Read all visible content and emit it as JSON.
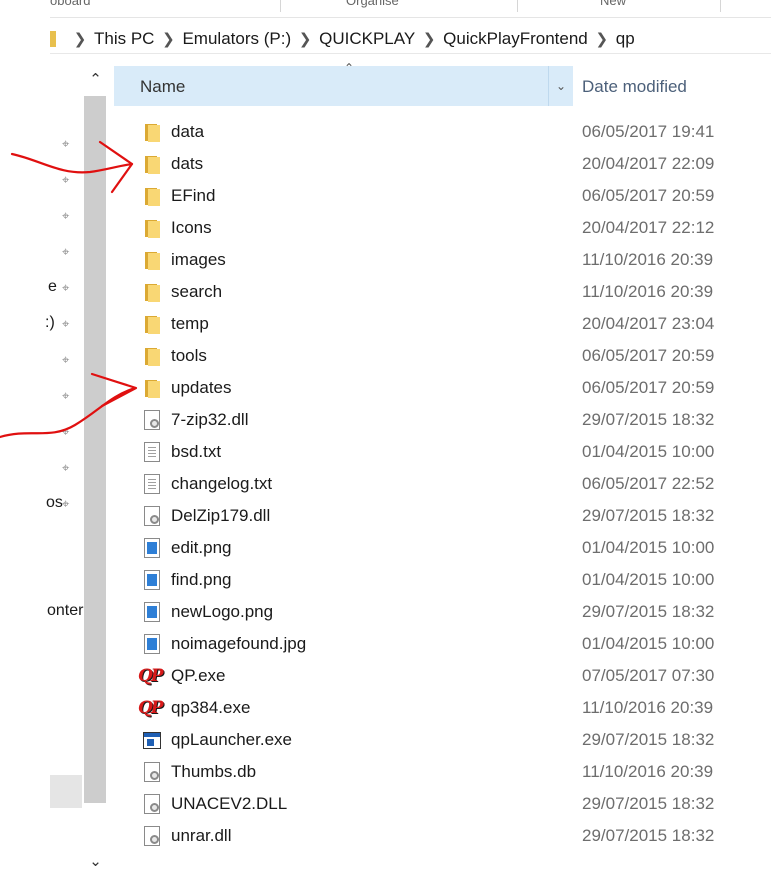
{
  "ribbon": {
    "groups": [
      "oboard",
      "Organise",
      "New"
    ]
  },
  "address": {
    "segments": [
      "This PC",
      "Emulators (P:)",
      "QUICKPLAY",
      "QuickPlayFrontend",
      "qp"
    ]
  },
  "nav_pane": {
    "labels": [
      "e",
      ":)",
      "os",
      "onter"
    ]
  },
  "columns": {
    "name": "Name",
    "date_modified": "Date modified"
  },
  "files": [
    {
      "name": "data",
      "date": "06/05/2017 19:41",
      "icon": "folder-icon"
    },
    {
      "name": "dats",
      "date": "20/04/2017 22:09",
      "icon": "folder-icon"
    },
    {
      "name": "EFind",
      "date": "06/05/2017 20:59",
      "icon": "folder-icon"
    },
    {
      "name": "Icons",
      "date": "20/04/2017 22:12",
      "icon": "folder-icon"
    },
    {
      "name": "images",
      "date": "11/10/2016 20:39",
      "icon": "folder-icon"
    },
    {
      "name": "search",
      "date": "11/10/2016 20:39",
      "icon": "folder-icon"
    },
    {
      "name": "temp",
      "date": "20/04/2017 23:04",
      "icon": "folder-icon"
    },
    {
      "name": "tools",
      "date": "06/05/2017 20:59",
      "icon": "folder-icon"
    },
    {
      "name": "updates",
      "date": "06/05/2017 20:59",
      "icon": "folder-icon"
    },
    {
      "name": "7-zip32.dll",
      "date": "29/07/2015 18:32",
      "icon": "dll-icon"
    },
    {
      "name": "bsd.txt",
      "date": "01/04/2015 10:00",
      "icon": "text-file-icon"
    },
    {
      "name": "changelog.txt",
      "date": "06/05/2017 22:52",
      "icon": "text-file-icon"
    },
    {
      "name": "DelZip179.dll",
      "date": "29/07/2015 18:32",
      "icon": "dll-icon"
    },
    {
      "name": "edit.png",
      "date": "01/04/2015 10:00",
      "icon": "image-file-icon"
    },
    {
      "name": "find.png",
      "date": "01/04/2015 10:00",
      "icon": "image-file-icon"
    },
    {
      "name": "newLogo.png",
      "date": "29/07/2015 18:32",
      "icon": "image-file-icon"
    },
    {
      "name": "noimagefound.jpg",
      "date": "01/04/2015 10:00",
      "icon": "image-file-icon"
    },
    {
      "name": "QP.exe",
      "date": "07/05/2017 07:30",
      "icon": "qp-app-icon"
    },
    {
      "name": "qp384.exe",
      "date": "11/10/2016 20:39",
      "icon": "qp-app-icon"
    },
    {
      "name": "qpLauncher.exe",
      "date": "29/07/2015 18:32",
      "icon": "exe-window-icon"
    },
    {
      "name": "Thumbs.db",
      "date": "11/10/2016 20:39",
      "icon": "dll-icon"
    },
    {
      "name": "UNACEV2.DLL",
      "date": "29/07/2015 18:32",
      "icon": "dll-icon"
    },
    {
      "name": "unrar.dll",
      "date": "29/07/2015 18:32",
      "icon": "dll-icon"
    }
  ],
  "annotations": {
    "color": "#e01010",
    "targets": [
      "dats",
      "updates"
    ]
  },
  "colors": {
    "header_bg": "#d9ebf9",
    "folder": "#f9d774",
    "date_text": "#6d6d6d"
  }
}
